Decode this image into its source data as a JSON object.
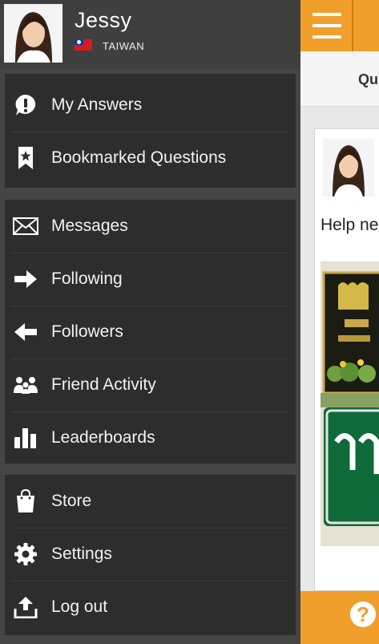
{
  "profile": {
    "name": "Jessy",
    "country": "TAIWAN"
  },
  "menu": {
    "group1": [
      {
        "label": "My Answers",
        "icon": "exclamation-bubble-icon"
      },
      {
        "label": "Bookmarked Questions",
        "icon": "bookmark-icon"
      }
    ],
    "group2": [
      {
        "label": "Messages",
        "icon": "envelope-icon"
      },
      {
        "label": "Following",
        "icon": "arrow-right-icon"
      },
      {
        "label": "Followers",
        "icon": "arrow-left-icon"
      },
      {
        "label": "Friend Activity",
        "icon": "people-icon"
      },
      {
        "label": "Leaderboards",
        "icon": "bar-chart-icon"
      }
    ],
    "group3": [
      {
        "label": "Store",
        "icon": "shopping-bag-icon"
      },
      {
        "label": "Settings",
        "icon": "gear-icon"
      },
      {
        "label": "Log out",
        "icon": "upload-icon"
      }
    ]
  },
  "main": {
    "tab_label": "Qu",
    "card_text": "Help ne"
  },
  "colors": {
    "accent": "#f0a02a",
    "drawer_bg": "#454545",
    "group_bg": "#2d2d2d"
  }
}
